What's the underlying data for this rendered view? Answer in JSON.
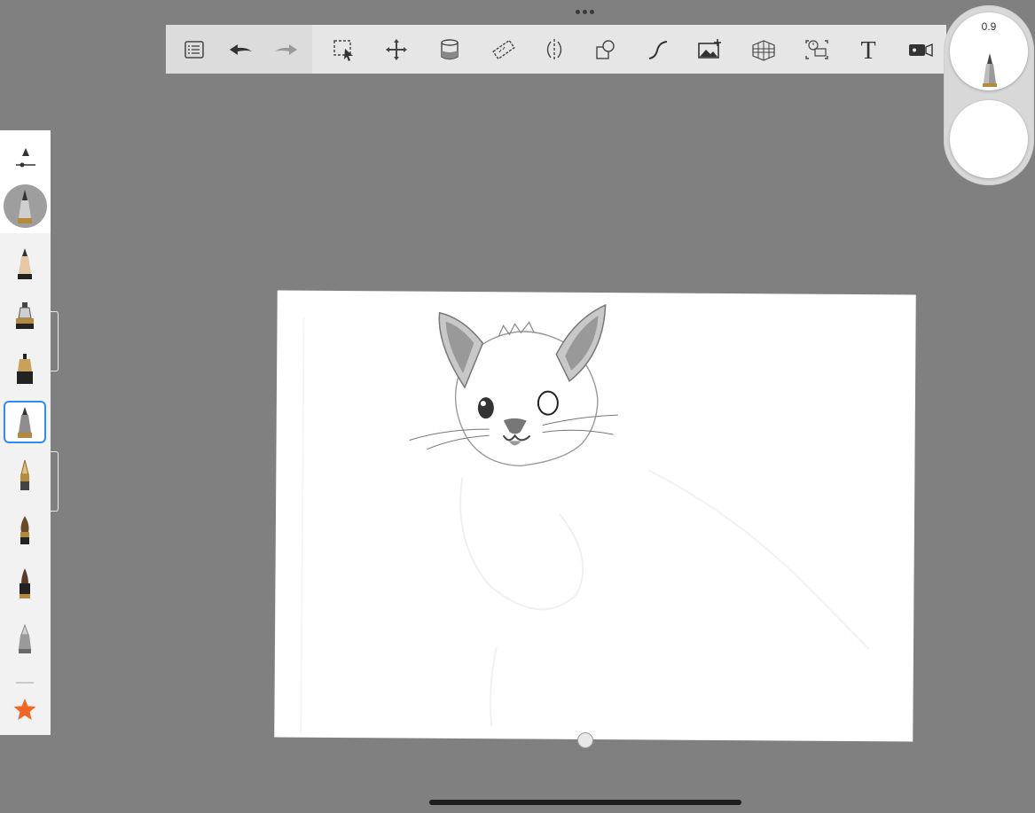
{
  "toolbar": {
    "tools": [
      {
        "name": "layers-list-icon"
      },
      {
        "name": "undo-icon"
      },
      {
        "name": "redo-icon"
      },
      {
        "name": "selection-icon"
      },
      {
        "name": "transform-icon"
      },
      {
        "name": "fill-bucket-icon"
      },
      {
        "name": "ruler-icon"
      },
      {
        "name": "symmetry-icon"
      },
      {
        "name": "shapes-icon"
      },
      {
        "name": "curve-icon"
      },
      {
        "name": "add-image-icon"
      },
      {
        "name": "perspective-grid-icon"
      },
      {
        "name": "time-lapse-icon"
      },
      {
        "name": "text-icon"
      },
      {
        "name": "record-video-icon"
      }
    ]
  },
  "brush_puck": {
    "size_value": "0.9",
    "color": "#ffffff"
  },
  "palette": {
    "accent": "#2d8cf0",
    "star_color": "#f26522"
  },
  "canvas": {
    "background": "#ffffff"
  }
}
